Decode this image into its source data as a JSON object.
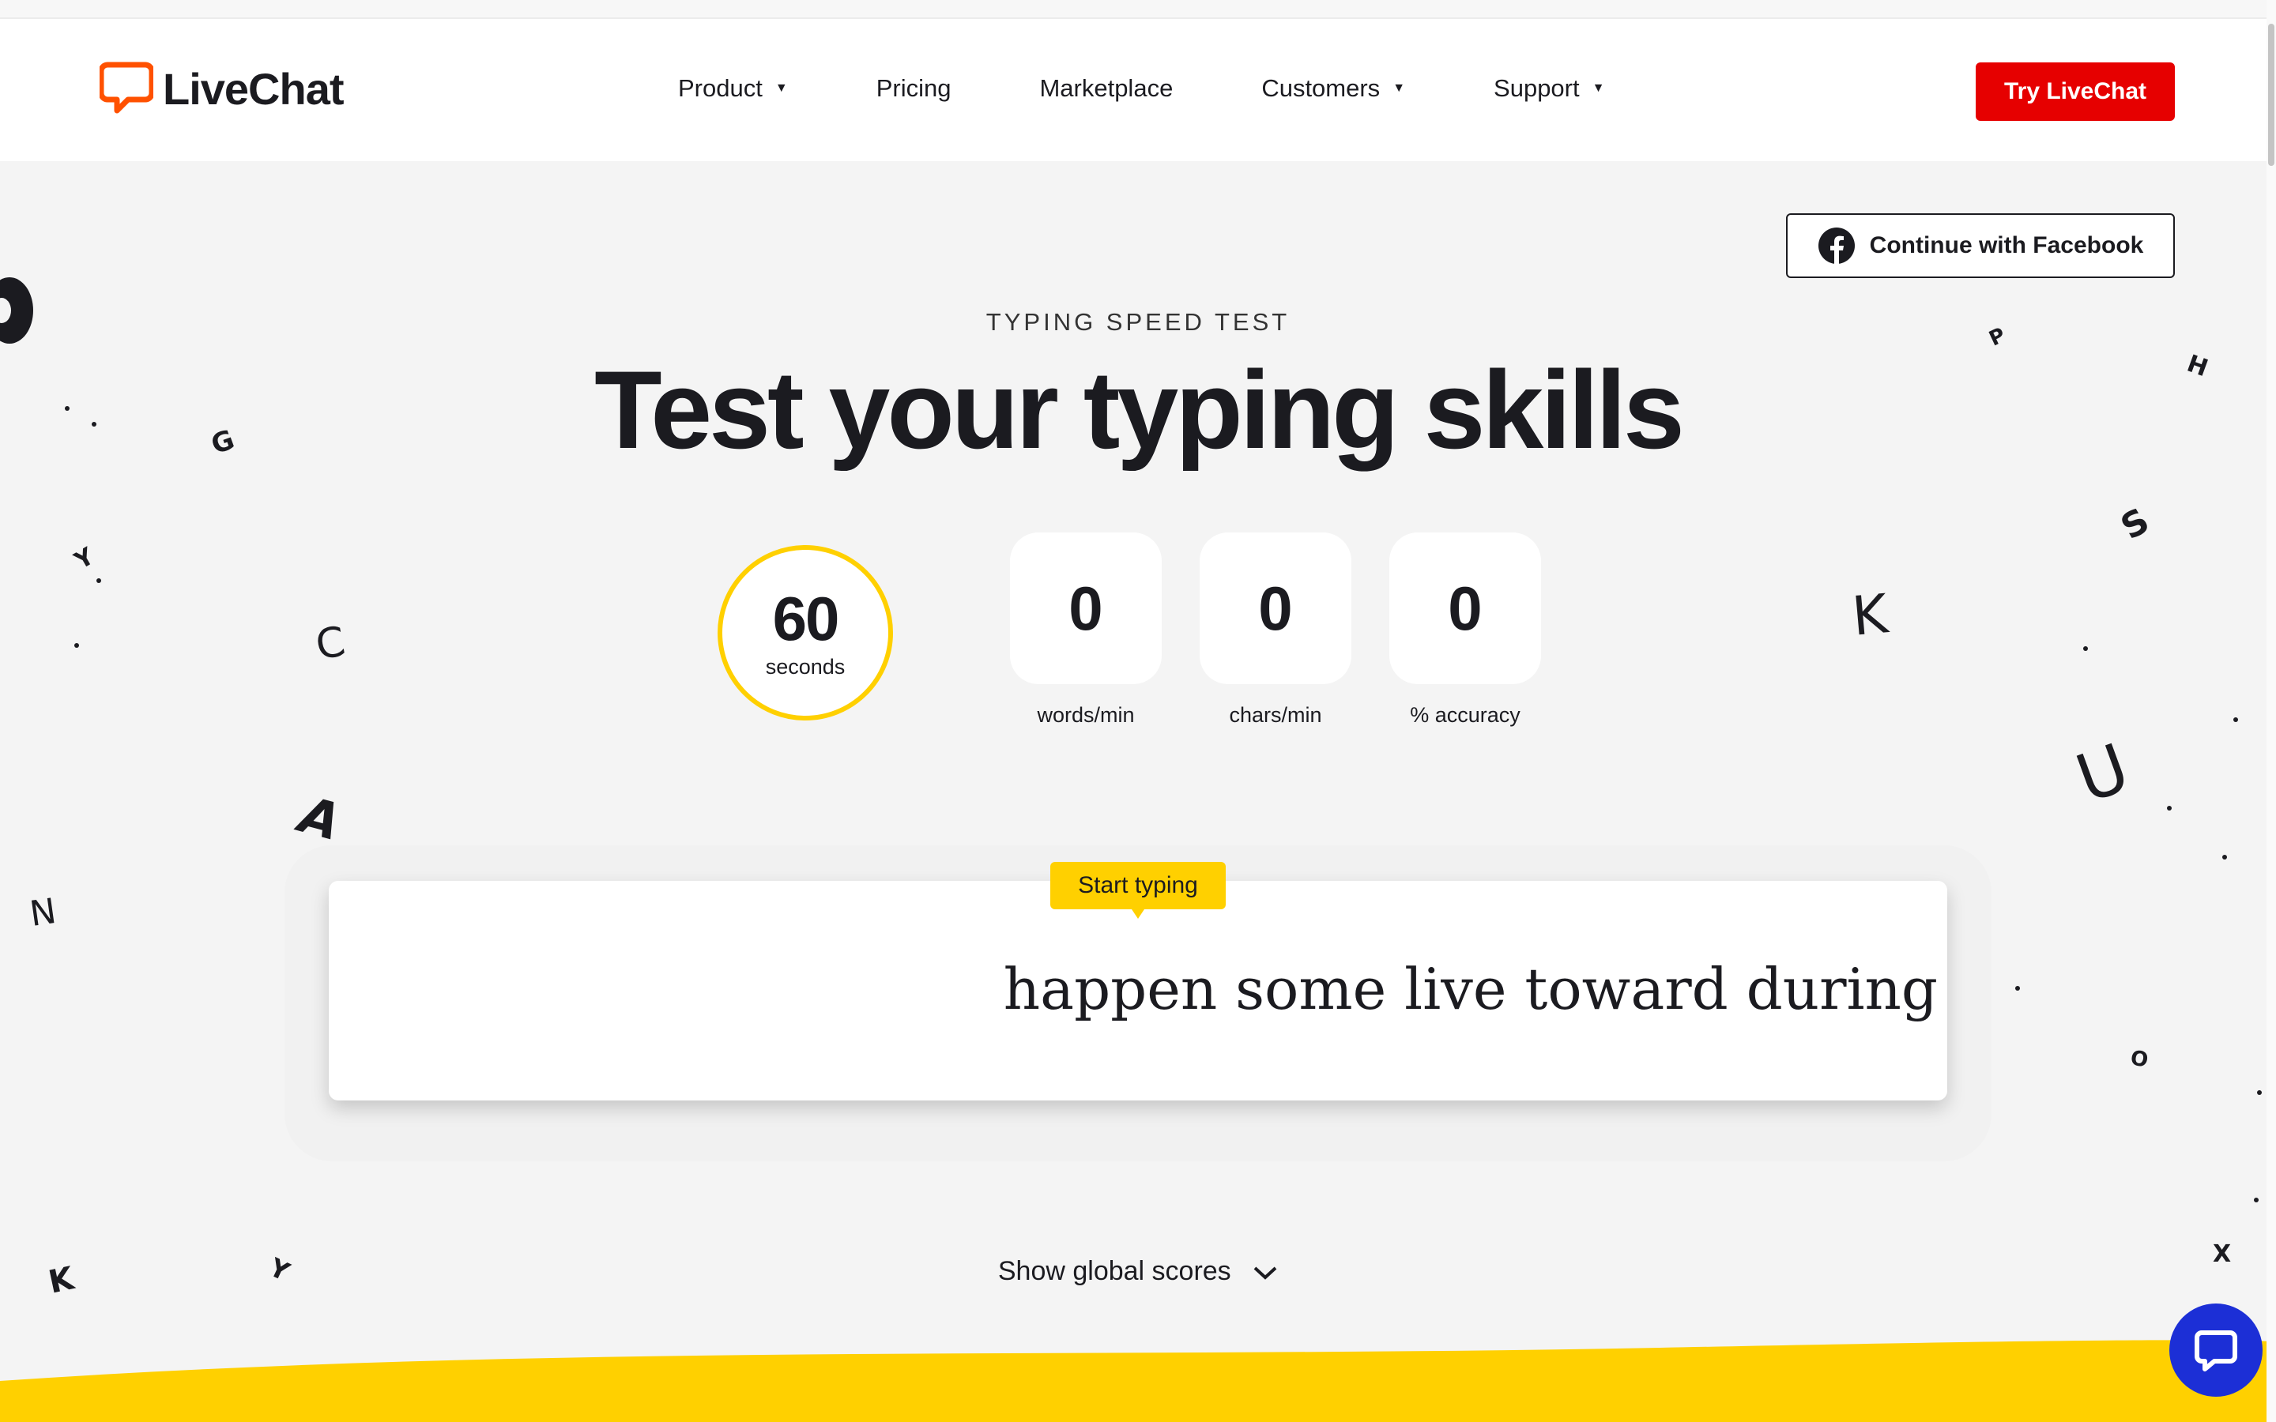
{
  "brand": {
    "name": "LiveChat",
    "accent": "#ff5100"
  },
  "nav": {
    "items": [
      {
        "label": "Product",
        "dropdown": true
      },
      {
        "label": "Pricing",
        "dropdown": false
      },
      {
        "label": "Marketplace",
        "dropdown": false
      },
      {
        "label": "Customers",
        "dropdown": true
      },
      {
        "label": "Support",
        "dropdown": true
      }
    ],
    "cta_label": "Try LiveChat",
    "cta_color": "#e60000"
  },
  "facebook": {
    "label": "Continue with Facebook",
    "icon": "facebook-icon"
  },
  "hero": {
    "eyebrow": "TYPING SPEED TEST",
    "title": "Test your typing skills"
  },
  "timer": {
    "value": "60",
    "unit": "seconds",
    "ring_color": "#ffd000"
  },
  "stats": [
    {
      "value": "0",
      "label": "words/min"
    },
    {
      "value": "0",
      "label": "chars/min"
    },
    {
      "value": "0",
      "label": "% accuracy"
    }
  ],
  "typing": {
    "tooltip": "Start typing",
    "words": "happen some live toward during"
  },
  "global_scores": {
    "label": "Show global scores",
    "icon": "chevron-down-icon"
  },
  "chat_widget": {
    "icon": "chat-bubble-icon",
    "color": "#1c2fd6"
  },
  "decor_letters": [
    "G",
    "Y",
    "C",
    "A",
    "N",
    "K",
    "Y",
    "P",
    "H",
    "S",
    "K",
    "U",
    "O",
    "X"
  ]
}
